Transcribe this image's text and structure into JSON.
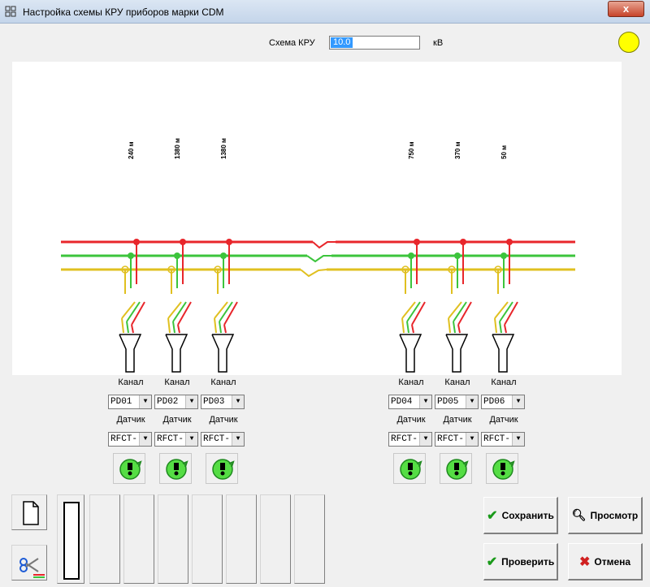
{
  "window": {
    "title": "Настройка схемы КРУ приборов марки CDM",
    "close_glyph": "x"
  },
  "header": {
    "scheme_label": "Схема КРУ",
    "voltage_value": "10.0",
    "voltage_unit": "кВ",
    "indicator_color": "#ffff00"
  },
  "scheme": {
    "bus_colors": {
      "phase_a": "#e8262b",
      "phase_b": "#3cc43c",
      "phase_c": "#e0c020"
    },
    "distances": [
      "240 м",
      "1380 м",
      "1380 м",
      "750 м",
      "370 м",
      "50 м"
    ],
    "channel_label": "Канал",
    "sensor_label": "Датчик",
    "channels": [
      "PD01",
      "PD02",
      "PD03",
      "PD04",
      "PD05",
      "PD06"
    ],
    "sensors": [
      "RFCT-",
      "RFCT-",
      "RFCT-",
      "RFCT-",
      "RFCT-",
      "RFCT-"
    ]
  },
  "toolbar": {
    "new_icon": "document-icon",
    "cut_icon": "scissors-icon"
  },
  "actions": {
    "save": "Сохранить",
    "preview": "Просмотр",
    "verify": "Проверить",
    "cancel": "Отмена"
  }
}
